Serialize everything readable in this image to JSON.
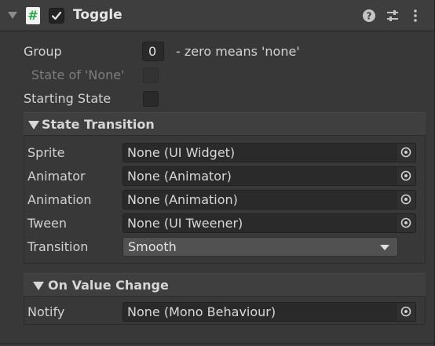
{
  "component": {
    "title": "Toggle",
    "icons": [
      "script-icon",
      "help-icon",
      "preset-icon",
      "menu-icon"
    ],
    "enabled": true
  },
  "fields": {
    "group_label": "Group",
    "group_value": "0",
    "group_hint": "- zero means 'none'",
    "state_none_label": "State of 'None'",
    "starting_state_label": "Starting State"
  },
  "state_transition": {
    "title": "State Transition",
    "rows": [
      {
        "label": "Sprite",
        "value": "None (UI Widget)"
      },
      {
        "label": "Animator",
        "value": "None (Animator)"
      },
      {
        "label": "Animation",
        "value": "None (Animation)"
      },
      {
        "label": "Tween",
        "value": "None (UI Tweener)"
      }
    ],
    "transition_label": "Transition",
    "transition_value": "Smooth"
  },
  "on_value_change": {
    "title": "On Value Change",
    "notify_label": "Notify",
    "notify_value": "None (Mono Behaviour)"
  },
  "colors": {
    "background": "#383838",
    "header": "#3e3e3e",
    "field": "#2a2a2a",
    "script_icon_green": "#2aa84a"
  }
}
